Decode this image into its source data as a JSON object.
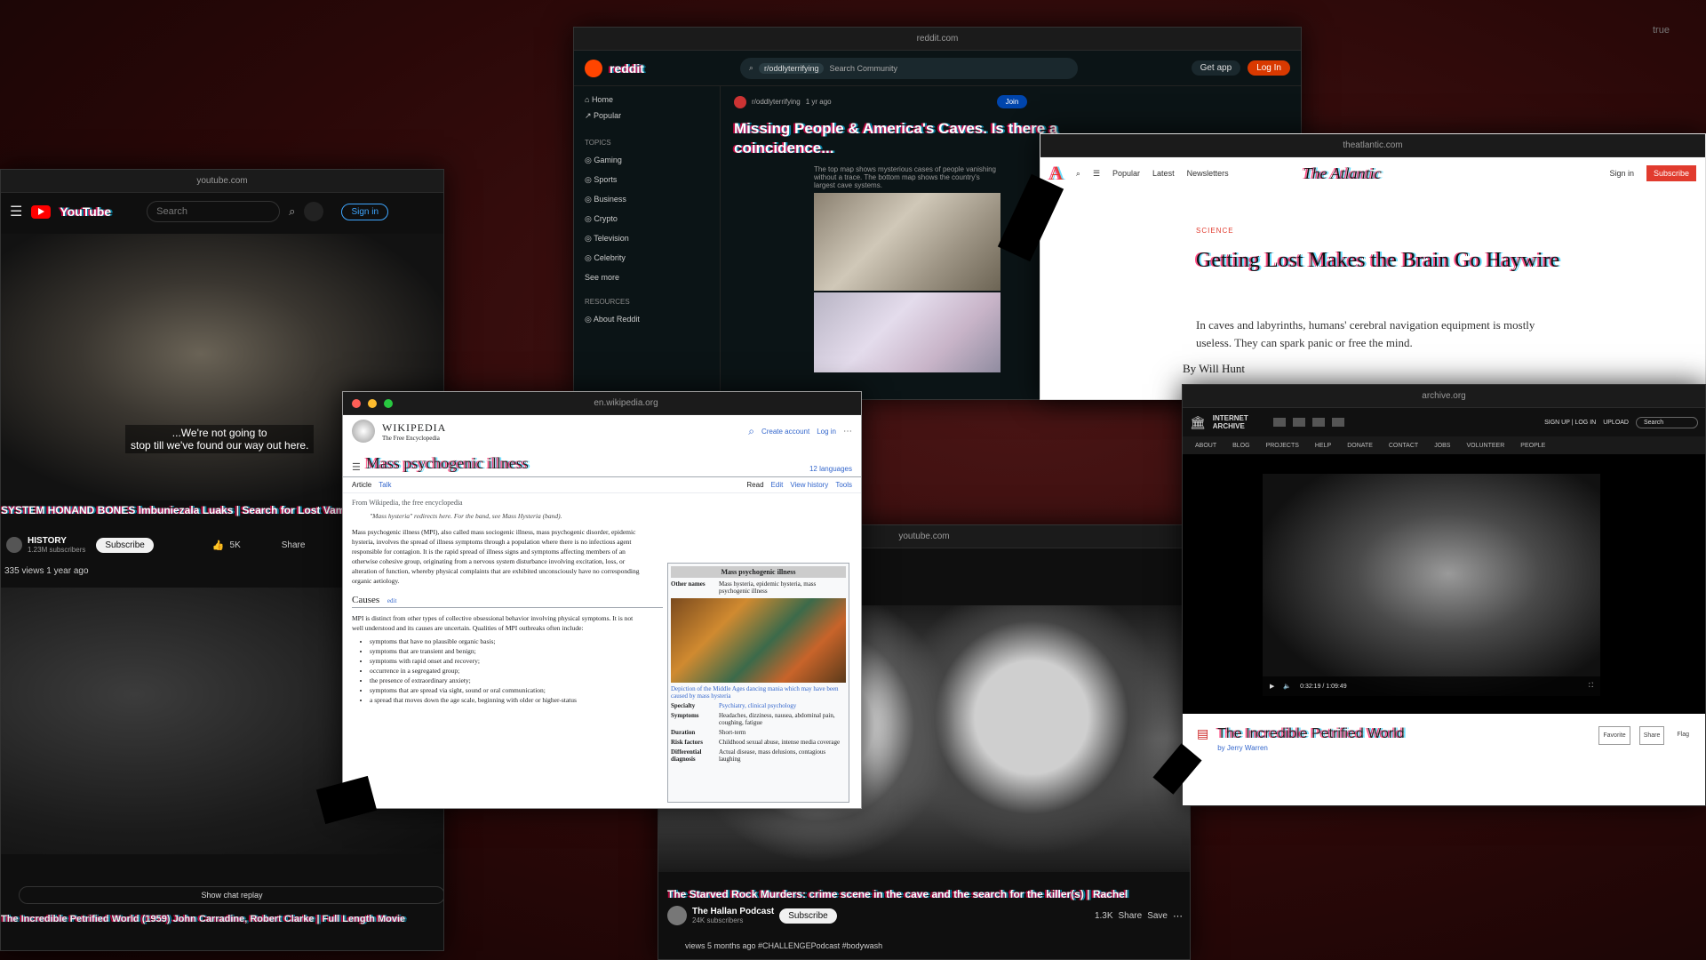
{
  "yt_left": {
    "url": "youtube.com",
    "logo": "YouTube",
    "search_placeholder": "Search",
    "sign_in": "Sign in",
    "caption_line1": "...We're not going to",
    "caption_line2": "stop till we've found our way out here.",
    "title": "SYSTEM HONAND BONES lmbuniezala Luaks | Search for Lost Vampire",
    "channel": "HISTORY",
    "subs": "1.23M subscribers",
    "subscribe": "Subscribe",
    "likes": "5K",
    "share": "Share",
    "meta": "335 views 1 year ago",
    "show_chat": "Show chat replay",
    "bottom_title": "The Incredible Petrified World (1959) John Carradine, Robert Clarke | Full Length Movie"
  },
  "reddit": {
    "url": "reddit.com",
    "logo": "reddit",
    "community": "r/oddlyterrifying",
    "search_placeholder": "Search Community",
    "get_app": "Get app",
    "login": "Log In",
    "nav": [
      "Home",
      "Popular"
    ],
    "topics_header": "TOPICS",
    "topics": [
      "Gaming",
      "Sports",
      "Business",
      "Crypto",
      "Television",
      "Celebrity"
    ],
    "see_more": "See more",
    "resources_header": "RESOURCES",
    "about": "About Reddit",
    "post_sub": "r/oddlyterrifying",
    "post_time": "1 yr ago",
    "join": "Join",
    "post_title": "Missing People & America's Caves. Is there a coincidence...",
    "post_body": "The top map shows mysterious cases of people vanishing without a trace. The bottom map shows the country's largest cave systems."
  },
  "atlantic": {
    "url": "theatlantic.com",
    "logo_a": "A",
    "nav": [
      "Popular",
      "Latest",
      "Newsletters"
    ],
    "logo": "The Atlantic",
    "sign_in": "Sign in",
    "subscribe": "Subscribe",
    "section": "SCIENCE",
    "headline": "Getting Lost Makes the Brain Go Haywire",
    "dek": "In caves and labyrinths, humans' cerebral navigation equipment is mostly useless. They can spark panic or free the mind.",
    "byline": "By Will Hunt"
  },
  "wiki": {
    "url": "en.wikipedia.org",
    "logo": "WIKIPEDIA",
    "tagline": "The Free Encyclopedia",
    "create_account": "Create account",
    "login": "Log in",
    "title": "Mass psychogenic illness",
    "languages": "12 languages",
    "tabs": [
      "Article",
      "Talk"
    ],
    "actions": [
      "Read",
      "Edit",
      "View history",
      "Tools"
    ],
    "from": "From Wikipedia, the free encyclopedia",
    "hatnote": "\"Mass hysteria\" redirects here. For the band, see Mass Hysteria (band).",
    "para1": "Mass psychogenic illness (MPI), also called mass sociogenic illness, mass psychogenic disorder, epidemic hysteria, involves the spread of illness symptoms through a population where there is no infectious agent responsible for contagion. It is the rapid spread of illness signs and symptoms affecting members of an otherwise cohesive group, originating from a nervous system disturbance involving excitation, loss, or alteration of function, whereby physical complaints that are exhibited unconsciously have no corresponding organic aetiology.",
    "section": "Causes",
    "edit": "edit",
    "para2": "MPI is distinct from other types of collective obsessional behavior involving physical symptoms. It is not well understood and its causes are uncertain. Qualities of MPI outbreaks often include:",
    "bullets": [
      "symptoms that have no plausible organic basis;",
      "symptoms that are transient and benign;",
      "symptoms with rapid onset and recovery;",
      "occurrence in a segregated group;",
      "the presence of extraordinary anxiety;",
      "symptoms that are spread via sight, sound or oral communication;",
      "a spread that moves down the age scale, beginning with older or higher-status"
    ],
    "infobox_title": "Mass psychogenic illness",
    "infobox_other": "Other names",
    "infobox_other_val": "Mass hysteria, epidemic hysteria, mass psychogenic illness",
    "infobox_caption": "Depiction of the Middle Ages dancing mania which may have been caused by mass hysteria",
    "infobox_rows": [
      {
        "k": "Specialty",
        "v": "Psychiatry, clinical psychology"
      },
      {
        "k": "Symptoms",
        "v": "Headaches, dizziness, nausea, abdominal pain, coughing, fatigue"
      },
      {
        "k": "Duration",
        "v": "Short-term"
      },
      {
        "k": "Risk factors",
        "v": "Childhood sexual abuse, intense media coverage"
      },
      {
        "k": "Differential diagnosis",
        "v": "Actual disease, mass delusions, contagious laughing"
      }
    ]
  },
  "archive": {
    "url": "archive.org",
    "logo": "INTERNET ARCHIVE",
    "signup": "SIGN UP | LOG IN",
    "upload": "UPLOAD",
    "search": "Search",
    "nav": [
      "ABOUT",
      "BLOG",
      "PROJECTS",
      "HELP",
      "DONATE",
      "CONTACT",
      "JOBS",
      "VOLUNTEER",
      "PEOPLE"
    ],
    "time": "0:32:19 / 1:09:49",
    "title": "The Incredible Petrified World",
    "by": "by Jerry Warren",
    "actions": [
      "Favorite",
      "Share",
      "Flag"
    ]
  },
  "yt_mid": {
    "url": "youtube.com",
    "title": "The Starved Rock Murders: crime scene in the cave and the search for the killer(s) | Rachel",
    "channel": "The Hallan Podcast",
    "subs": "24K subscribers",
    "subscribe": "Subscribe",
    "likes": "1.3K",
    "share": "Share",
    "save": "Save",
    "meta": "views 5 months ago #CHALLENGEPodcast #bodywash"
  },
  "corner_text": "true"
}
